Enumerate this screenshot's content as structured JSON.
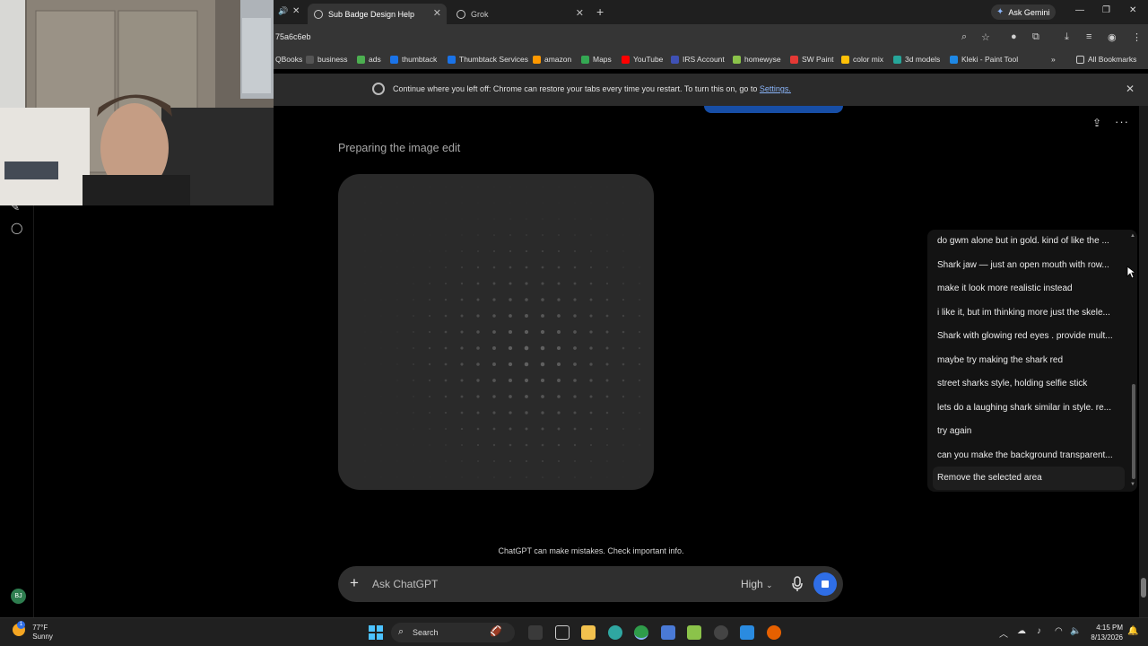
{
  "browser": {
    "tabs": [
      {
        "label": "Sub Badge Design Help",
        "active": true
      },
      {
        "label": "Grok",
        "active": false
      }
    ],
    "ask_gemini_label": "Ask Gemini",
    "url": "75a6c6eb",
    "bookmarks": [
      "QBooks",
      "business",
      "ads",
      "thumbtack",
      "Thumbtack Services",
      "amazon",
      "Maps",
      "YouTube",
      "IRS Account",
      "homewyse",
      "SW Paint",
      "color mix",
      "3d models",
      "Kleki - Paint Tool"
    ],
    "all_bookmarks_label": "All Bookmarks",
    "infobar": {
      "message": "Continue where you left off: Chrome can restore your tabs every time you restart. To turn this on, go to",
      "link": "Settings."
    }
  },
  "chat": {
    "status": "Preparing the image edit",
    "history_prompts": [
      "do gwm alone but in gold. kind of like the ...",
      "Shark jaw — just an open mouth with row...",
      "make it look more realistic instead",
      "i like it, but im thinking more just the skele...",
      "Shark with glowing red eyes . provide mult...",
      "maybe try making the shark red",
      "street sharks style, holding selfie stick",
      "lets do a laughing shark similar in style. re...",
      "try again",
      "can you make the background transparent...",
      "Remove the selected area"
    ],
    "disclaimer": "ChatGPT can make mistakes. Check important info.",
    "composer": {
      "placeholder": "Ask ChatGPT",
      "mode": "High"
    },
    "avatar_initials": "BJ"
  },
  "taskbar": {
    "weather_temp": "77°F",
    "weather_desc": "Sunny",
    "weather_badge": "1",
    "search_label": "Search",
    "time": "4:15 PM",
    "date": "8/13/2026"
  },
  "colors": {
    "accent": "#2f6ee6",
    "link": "#8ab4f8",
    "panel": "#131313"
  }
}
